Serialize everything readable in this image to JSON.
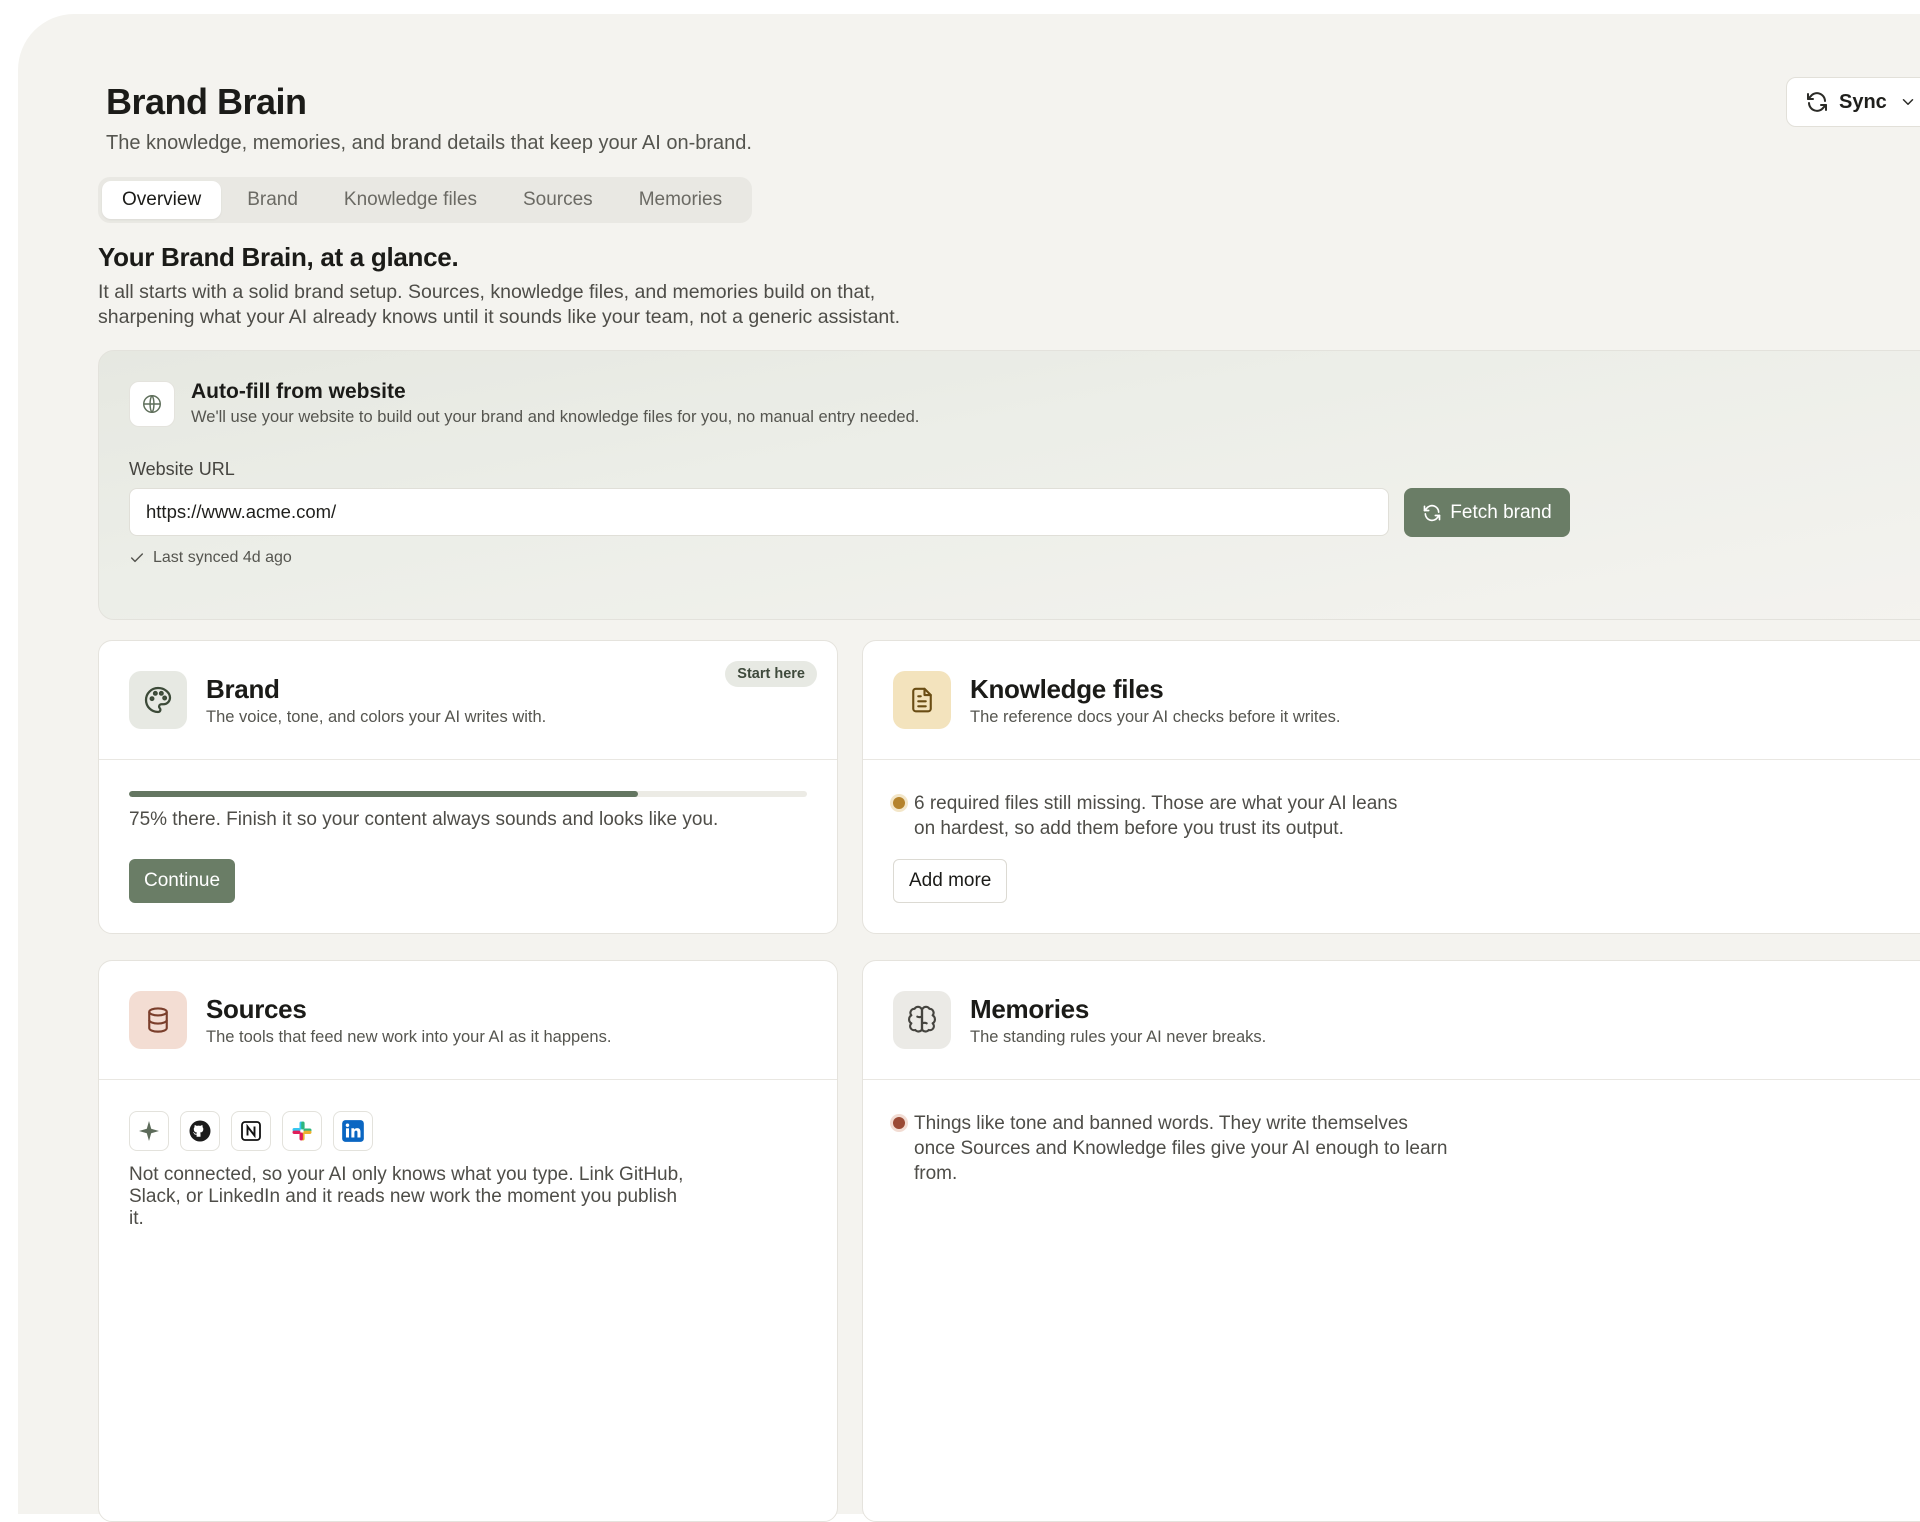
{
  "header": {
    "title": "Brand Brain",
    "subtitle": "The knowledge, memories, and brand details that keep your AI on-brand.",
    "sync_label": "Sync"
  },
  "tabs": [
    {
      "label": "Overview",
      "active": true
    },
    {
      "label": "Brand",
      "active": false
    },
    {
      "label": "Knowledge files",
      "active": false
    },
    {
      "label": "Sources",
      "active": false
    },
    {
      "label": "Memories",
      "active": false
    }
  ],
  "overview": {
    "title": "Your Brand Brain, at a glance.",
    "description": "It all starts with a solid brand setup. Sources, knowledge files, and memories build on that, sharpening what your AI already knows until it sounds like your team, not a generic assistant."
  },
  "autofill": {
    "icon": "globe-icon",
    "title": "Auto-fill from website",
    "description": "We'll use your website to build out your brand and knowledge files for you, no manual entry needed.",
    "url_label": "Website URL",
    "url_value": "https://www.acme.com/",
    "fetch_label": "Fetch brand",
    "synced_text": "Last synced 4d ago"
  },
  "cards": {
    "brand": {
      "icon": "palette-icon",
      "title": "Brand",
      "description": "The voice, tone, and colors your AI writes with.",
      "badge": "Start here",
      "progress": 0.75,
      "progress_text": "75% there. Finish it so your content always sounds and looks like you.",
      "button": "Continue"
    },
    "knowledge": {
      "icon": "document-icon",
      "title": "Knowledge files",
      "description": "The reference docs your AI checks before it writes.",
      "status": "6 required files still missing. Those are what your AI leans on hardest, so add them before you trust its output.",
      "button": "Add more"
    },
    "sources": {
      "icon": "database-icon",
      "title": "Sources",
      "description": "The tools that feed new work into your AI as it happens.",
      "integrations": [
        "sparkle-icon",
        "github-icon",
        "notion-icon",
        "slack-icon",
        "linkedin-icon"
      ],
      "status": "Not connected, so your AI only knows what you type. Link GitHub, Slack, or LinkedIn and it reads new work the moment you publish it."
    },
    "memories": {
      "icon": "brain-icon",
      "title": "Memories",
      "description": "The standing rules your AI never breaks.",
      "status": "Things like tone and banned words. They write themselves once Sources and Knowledge files give your AI enough to learn from."
    }
  },
  "colors": {
    "accent": "#6a7d66",
    "background": "#f4f3ef",
    "warning_dot": "#b5832c",
    "alert_dot": "#9a4a35"
  }
}
